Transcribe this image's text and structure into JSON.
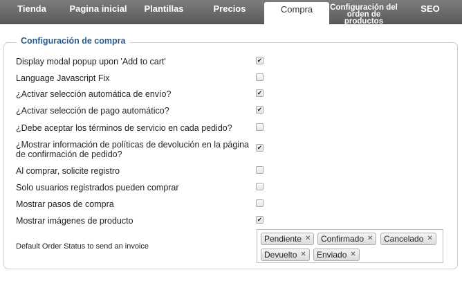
{
  "tabs": [
    {
      "label": "Tienda"
    },
    {
      "label": "Pagina inicial"
    },
    {
      "label": "Plantillas"
    },
    {
      "label": "Precios"
    },
    {
      "label": "Compra"
    },
    {
      "label": "Configuración del orden de productos"
    },
    {
      "label": "SEO"
    }
  ],
  "section": {
    "legend": "Configuración de compra"
  },
  "settings": [
    {
      "label": "Display modal popup upon 'Add to cart'",
      "checked": true
    },
    {
      "label": "Language Javascript Fix",
      "checked": false
    },
    {
      "label": "¿Activar selección automática de envío?",
      "checked": true
    },
    {
      "label": "¿Activar selección de pago automático?",
      "checked": true
    },
    {
      "label": "¿Debe aceptar los términos de servicio en cada pedido?",
      "checked": false
    },
    {
      "label": "¿Mostrar información de políticas de devolución en la página de confirmación de pedido?",
      "checked": true
    },
    {
      "label": "Al comprar, solicite registro",
      "checked": false
    },
    {
      "label": "Solo usuarios registrados pueden comprar",
      "checked": false
    },
    {
      "label": "Mostrar pasos de compra",
      "checked": false
    },
    {
      "label": "Mostrar imágenes de producto",
      "checked": true
    }
  ],
  "invoice_status": {
    "label": "Default Order Status to send an invoice",
    "tags": [
      "Pendiente",
      "Confirmado",
      "Cancelado",
      "Devuelto",
      "Enviado"
    ],
    "remove_glyph": "✕"
  },
  "check_glyph": "✔"
}
